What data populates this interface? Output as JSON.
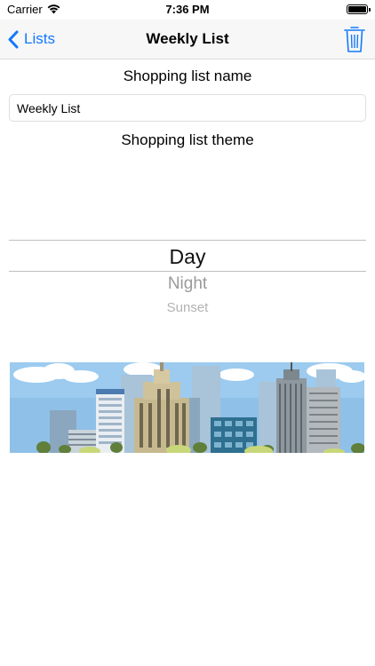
{
  "status_bar": {
    "carrier": "Carrier",
    "time": "7:36 PM",
    "wifi_icon": "wifi-icon",
    "battery_icon": "battery-icon"
  },
  "nav": {
    "back_label": "Lists",
    "back_icon": "chevron-left-icon",
    "title": "Weekly List",
    "trash_icon": "trash-icon",
    "accent": "#1479fb"
  },
  "form": {
    "name_label": "Shopping list name",
    "name_value": "Weekly List",
    "theme_label": "Shopping list theme"
  },
  "theme_picker": {
    "options": [
      "Day",
      "Night",
      "Sunset"
    ],
    "selected": "Day"
  },
  "theme_image": {
    "description_icon": "city-skyline-image"
  }
}
